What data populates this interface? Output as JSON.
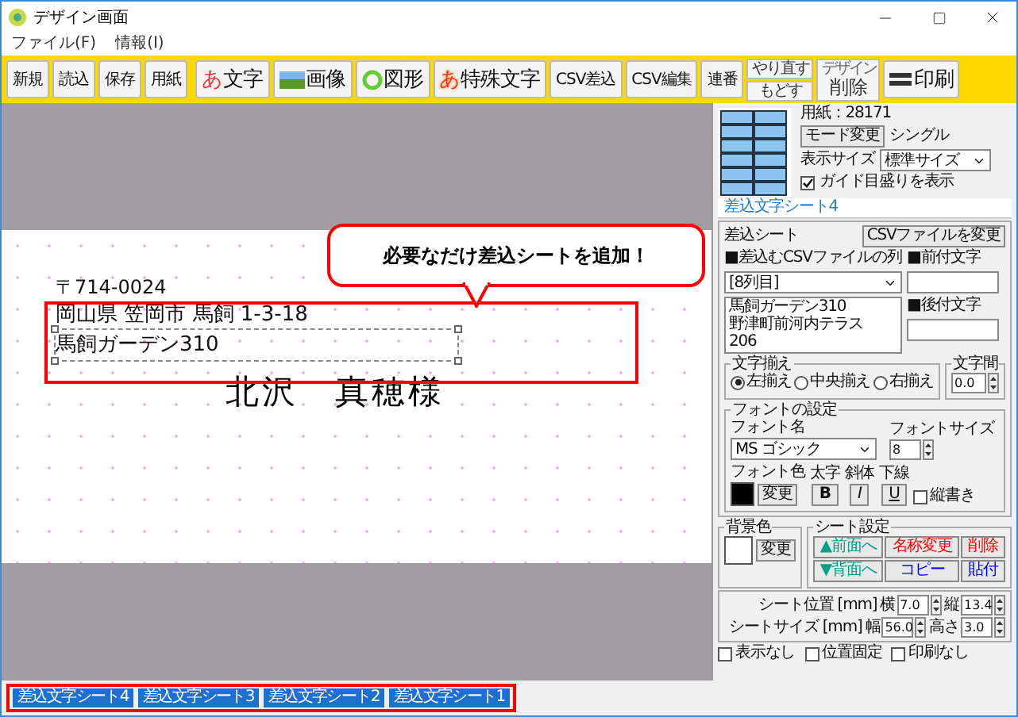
{
  "window": {
    "title": "デザイン画面"
  },
  "menu": [
    "ファイル(F)",
    "情報(I)"
  ],
  "toolbar": [
    [
      {
        "kind": "plain",
        "label": "新規"
      },
      {
        "kind": "plain",
        "label": "読込"
      },
      {
        "kind": "plain",
        "label": "保存"
      },
      {
        "kind": "plain",
        "label": "用紙"
      }
    ],
    [
      {
        "kind": "glyph",
        "glyph": "あ",
        "label": "文字"
      },
      {
        "kind": "image",
        "label": "画像"
      },
      {
        "kind": "shape",
        "label": "図形"
      },
      {
        "kind": "fancy",
        "glyph": "あ",
        "label": "特殊文字"
      },
      {
        "kind": "plain",
        "label": "CSV差込"
      },
      {
        "kind": "plain",
        "label": "CSV編集"
      },
      {
        "kind": "plain",
        "label": "連番"
      },
      {
        "kind": "stack",
        "top": "やり直す",
        "label": "もどす"
      },
      {
        "kind": "caption",
        "top": "デザイン",
        "label": "削除"
      },
      {
        "kind": "print",
        "label": "印刷"
      }
    ]
  ],
  "canvas": {
    "postal": "〒714-0024",
    "lines": [
      {
        "text": "岡山県 笠岡市 馬飼 1-3-18",
        "selected": false
      },
      {
        "text": "馬飼ガーデン310",
        "selected": true
      }
    ],
    "name": "北沢　真穂様",
    "callout": "必要なだけ差込シートを追加！"
  },
  "panel": {
    "paper": "用紙：28171",
    "mode_button": "モード変更",
    "mode": "シングル",
    "display_size": {
      "label": "表示サイズ",
      "value": "標準サイズ"
    },
    "guide": {
      "label": "ガイド目盛りを表示",
      "checked": true
    },
    "sheet_title": "差込文字シート4",
    "merge": {
      "label": "差込シート",
      "csv_button": "CSVファイルを変更",
      "column_label": "■差込むCSVファイルの列",
      "column_value": "[8列目]",
      "preview": [
        "馬飼ガーデン310",
        "野津町前河内テラス",
        "206"
      ],
      "prefix_label": "■前付文字",
      "suffix_label": "■後付文字"
    },
    "align": {
      "label": "文字揃え",
      "options": [
        {
          "label": "左揃え",
          "selected": true
        },
        {
          "label": "中央揃え",
          "selected": false
        },
        {
          "label": "右揃え",
          "selected": false
        }
      ]
    },
    "spacing": {
      "label": "文字間",
      "value": "0.0"
    },
    "font": {
      "label": "フォントの設定",
      "name_label": "フォント名",
      "name": "MS ゴシック",
      "size_label": "フォントサイズ",
      "size": "8",
      "color_label": "フォント色",
      "color": "#000000",
      "change": "変更",
      "styles": [
        {
          "label": "太字",
          "key": "B",
          "on": false
        },
        {
          "label": "斜体",
          "key": "I",
          "on": false
        },
        {
          "label": "下線",
          "key": "U",
          "on": false
        }
      ],
      "vertical": {
        "label": "縦書き",
        "checked": false
      }
    },
    "background": {
      "label": "背景色",
      "color": "#ffffff",
      "button": "変更"
    },
    "sheet_settings": {
      "label": "シート設定",
      "buttons": [
        {
          "label": "▲前面へ",
          "color": "#00a08a"
        },
        {
          "label": "名称変更",
          "color": "#ff0000"
        },
        {
          "label": "削除",
          "color": "#ff0000"
        },
        {
          "label": "▼背面へ",
          "color": "#00a08a"
        },
        {
          "label": "コピー",
          "color": "#0000ff"
        },
        {
          "label": "貼付",
          "color": "#0000ff"
        }
      ]
    },
    "position": [
      {
        "label": "シート位置 [mm]",
        "fields": [
          {
            "label": "横",
            "value": "7.0"
          },
          {
            "label": "縦",
            "value": "13.4"
          }
        ]
      },
      {
        "label": "シートサイズ [mm]",
        "fields": [
          {
            "label": "幅",
            "value": "56.0"
          },
          {
            "label": "高さ",
            "value": "3.0"
          }
        ]
      }
    ],
    "flags": [
      {
        "label": "表示なし",
        "checked": false
      },
      {
        "label": "位置固定",
        "checked": false
      },
      {
        "label": "印刷なし",
        "checked": false
      }
    ]
  },
  "sheet_tabs": [
    "差込文字シート4",
    "差込文字シート3",
    "差込文字シート2",
    "差込文字シート1"
  ]
}
